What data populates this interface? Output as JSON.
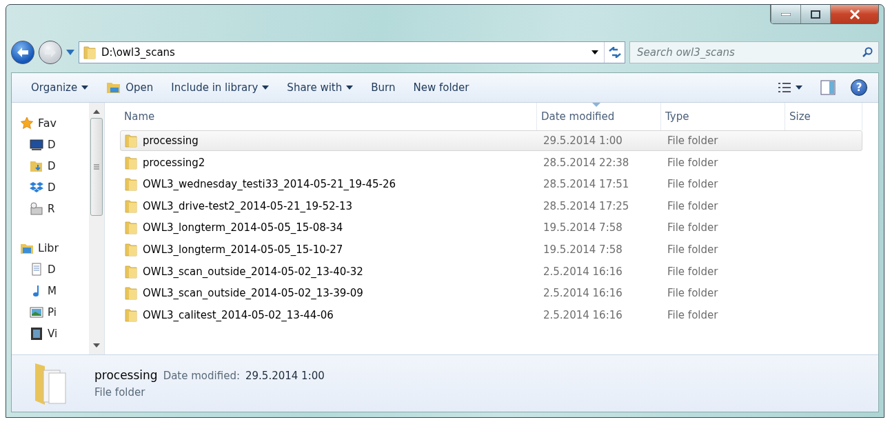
{
  "address_bar": {
    "path": "D:\\owl3_scans"
  },
  "search": {
    "placeholder": "Search owl3_scans"
  },
  "help_button": {
    "label": "?"
  },
  "toolbar": [
    {
      "label": "Organize",
      "dropdown": true,
      "kind": "text"
    },
    {
      "label": "Open",
      "dropdown": false,
      "kind": "open"
    },
    {
      "label": "Include in library",
      "dropdown": true,
      "kind": "text"
    },
    {
      "label": "Share with",
      "dropdown": true,
      "kind": "text"
    },
    {
      "label": "Burn",
      "dropdown": false,
      "kind": "text"
    },
    {
      "label": "New folder",
      "dropdown": false,
      "kind": "text"
    }
  ],
  "navigation": [
    {
      "label": "Fav",
      "kind": "star",
      "group": true
    },
    {
      "label": "D",
      "kind": "desktop",
      "group": false
    },
    {
      "label": "D",
      "kind": "downloads",
      "group": false
    },
    {
      "label": "D",
      "kind": "dropbox",
      "group": false
    },
    {
      "label": "R",
      "kind": "recent",
      "group": false
    },
    {
      "label": "Libr",
      "kind": "library",
      "group": true
    },
    {
      "label": "D",
      "kind": "documents",
      "group": false
    },
    {
      "label": "M",
      "kind": "music",
      "group": false
    },
    {
      "label": "Pi",
      "kind": "pictures",
      "group": false
    },
    {
      "label": "Vi",
      "kind": "videos",
      "group": false
    }
  ],
  "table": {
    "columns": [
      {
        "label": "Name",
        "sorted": false
      },
      {
        "label": "Date modified",
        "sorted": true
      },
      {
        "label": "Type",
        "sorted": false
      },
      {
        "label": "Size",
        "sorted": false
      }
    ],
    "rows": [
      {
        "name": "processing",
        "date": "29.5.2014 1:00",
        "type": "File folder",
        "selected": true
      },
      {
        "name": "processing2",
        "date": "28.5.2014 22:38",
        "type": "File folder",
        "selected": false
      },
      {
        "name": "OWL3_wednesday_testi33_2014-05-21_19-45-26",
        "date": "28.5.2014 17:51",
        "type": "File folder",
        "selected": false
      },
      {
        "name": "OWL3_drive-test2_2014-05-21_19-52-13",
        "date": "28.5.2014 17:25",
        "type": "File folder",
        "selected": false
      },
      {
        "name": "OWL3_longterm_2014-05-05_15-08-34",
        "date": "19.5.2014 7:58",
        "type": "File folder",
        "selected": false
      },
      {
        "name": "OWL3_longterm_2014-05-05_15-10-27",
        "date": "19.5.2014 7:58",
        "type": "File folder",
        "selected": false
      },
      {
        "name": "OWL3_scan_outside_2014-05-02_13-40-32",
        "date": "2.5.2014 16:16",
        "type": "File folder",
        "selected": false
      },
      {
        "name": "OWL3_scan_outside_2014-05-02_13-39-09",
        "date": "2.5.2014 16:16",
        "type": "File folder",
        "selected": false
      },
      {
        "name": "OWL3_calitest_2014-05-02_13-44-06",
        "date": "2.5.2014 16:16",
        "type": "File folder",
        "selected": false
      }
    ]
  },
  "details_pane": {
    "name": "processing",
    "date_label": "Date modified:",
    "date": "29.5.2014 1:00",
    "type": "File folder"
  }
}
